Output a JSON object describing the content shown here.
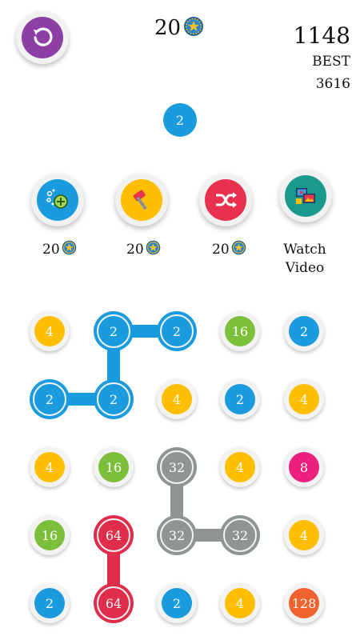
{
  "header": {
    "undo_icon": "undo-icon",
    "coins": "20",
    "coin_icon": "star-coin-icon",
    "score": "1148",
    "best_label": "BEST",
    "best_value": "3616"
  },
  "next_ball": {
    "value": "2",
    "color": "#1a9be0"
  },
  "powerups": [
    {
      "name": "bomb-plus",
      "icon": "bubbles-plus-icon",
      "color": "#1a9be0",
      "cost": "20"
    },
    {
      "name": "hammer",
      "icon": "hammer-icon",
      "color": "#ffbe00",
      "cost": "20"
    },
    {
      "name": "shuffle",
      "icon": "shuffle-icon",
      "color": "#e8304f",
      "cost": "20"
    },
    {
      "name": "watch-video",
      "icon": "video-gallery-icon",
      "color": "#1a9a8c",
      "label_line1": "Watch",
      "label_line2": "Video"
    }
  ],
  "colors": {
    "2": "#1a9be0",
    "4": "#ffbe00",
    "8": "#ec1f7d",
    "16": "#7cbf3b",
    "32": "#8f9494",
    "64": "#df2d4b",
    "128": "#f0622d"
  },
  "board": [
    [
      "4",
      "2",
      "2",
      "16",
      "2"
    ],
    [
      "2",
      "2",
      "4",
      "2",
      "4"
    ],
    [
      "4",
      "16",
      "32",
      "4",
      "8"
    ],
    [
      "16",
      "64",
      "32",
      "32",
      "4"
    ],
    [
      "2",
      "64",
      "2",
      "4",
      "128"
    ]
  ],
  "paths": [
    {
      "color": "#1a9be0",
      "cells": [
        [
          0,
          2
        ],
        [
          0,
          1
        ],
        [
          1,
          1
        ],
        [
          1,
          0
        ]
      ]
    },
    {
      "color": "#8f9494",
      "cells": [
        [
          2,
          2
        ],
        [
          3,
          2
        ],
        [
          3,
          3
        ]
      ]
    },
    {
      "color": "#df2d4b",
      "cells": [
        [
          3,
          1
        ],
        [
          4,
          1
        ]
      ]
    }
  ]
}
